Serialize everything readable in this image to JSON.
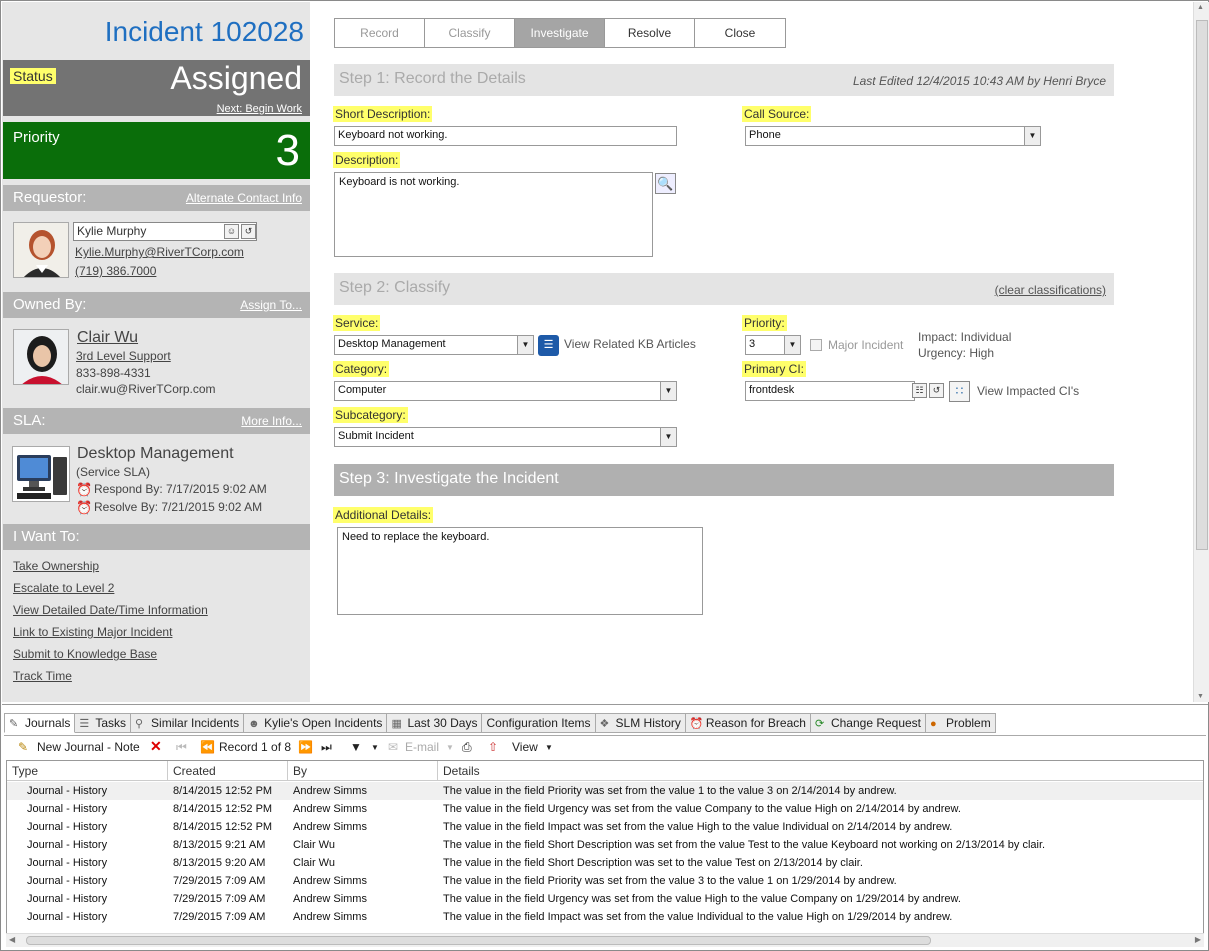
{
  "incident": {
    "title": "Incident 102028"
  },
  "status": {
    "label": "Status",
    "value": "Assigned",
    "next": "Next: Begin Work"
  },
  "priority": {
    "label": "Priority",
    "value": "3"
  },
  "requestor": {
    "head": "Requestor:",
    "link": "Alternate Contact Info",
    "name": "Kylie Murphy",
    "email": "Kylie.Murphy@RiverTCorp.com",
    "phone": "(719) 386.7000"
  },
  "owner": {
    "head": "Owned By:",
    "link": "Assign To...",
    "name": "Clair Wu",
    "group": "3rd Level Support",
    "phone": "833-898-4331",
    "email": "clair.wu@RiverTCorp.com"
  },
  "sla": {
    "head": "SLA:",
    "link": "More Info...",
    "name": "Desktop Management",
    "type": "(Service SLA)",
    "respond": "Respond By: 7/17/2015 9:02 AM",
    "resolve": "Resolve By: 7/21/2015 9:02 AM"
  },
  "iwant": {
    "head": "I Want To:",
    "links": [
      "Take Ownership",
      "Escalate to Level 2",
      "View Detailed Date/Time Information",
      "Link to Existing Major Incident",
      "Submit to Knowledge Base",
      "Track Time"
    ]
  },
  "workflow_tabs": [
    "Record",
    "Classify",
    "Investigate",
    "Resolve",
    "Close"
  ],
  "step1": {
    "title": "Step 1:  Record the Details",
    "edited": "Last Edited 12/4/2015 10:43 AM by Henri Bryce",
    "short_desc_label": "Short Description:",
    "short_desc_value": "Keyboard not working.",
    "call_source_label": "Call Source:",
    "call_source_value": "Phone",
    "desc_label": "Description:",
    "desc_value": "Keyboard is not working."
  },
  "step2": {
    "title": "Step 2:  Classify",
    "clear": "(clear classifications)",
    "service_label": "Service:",
    "service_value": "Desktop Management",
    "kb_link": "View Related KB Articles",
    "priority_label": "Priority:",
    "priority_value": "3",
    "major_incident": "Major Incident",
    "impact": "Impact: Individual",
    "urgency": "Urgency: High",
    "category_label": "Category:",
    "category_value": "Computer",
    "primary_ci_label": "Primary CI:",
    "primary_ci_value": "frontdesk",
    "impacted_ci": "View Impacted CI's",
    "subcategory_label": "Subcategory:",
    "subcategory_value": "Submit Incident"
  },
  "step3": {
    "title": "Step 3:  Investigate the Incident",
    "details_label": "Additional Details:",
    "details_value": "Need to replace the keyboard."
  },
  "bottom_tabs": [
    "Journals",
    "Tasks",
    "Similar Incidents",
    "Kylie's Open Incidents",
    "Last 30 Days",
    "Configuration Items",
    "SLM History",
    "Reason for Breach",
    "Change Request",
    "Problem"
  ],
  "toolbar": {
    "new_journal": "New Journal - Note",
    "record": "Record 1 of 8",
    "email": "E-mail",
    "view": "View"
  },
  "grid": {
    "columns": [
      "Type",
      "Created",
      "By",
      "Details"
    ],
    "rows": [
      [
        "Journal - History",
        "8/14/2015  12:52 PM",
        "Andrew Simms",
        "The value in the field Priority was set from the value 1 to the value 3 on 2/14/2014 by andrew."
      ],
      [
        "Journal - History",
        "8/14/2015  12:52 PM",
        "Andrew Simms",
        "The value in the field Urgency was set from the value Company to the value High on 2/14/2014 by andrew."
      ],
      [
        "Journal - History",
        "8/14/2015  12:52 PM",
        "Andrew Simms",
        "The value in the field Impact was set from the value High to the value Individual on 2/14/2014 by andrew."
      ],
      [
        "Journal - History",
        "8/13/2015  9:21 AM",
        "Clair Wu",
        "The value in the field Short Description was set from the value Test to the value Keyboard not working on 2/13/2014 by clair."
      ],
      [
        "Journal - History",
        "8/13/2015  9:20 AM",
        "Clair Wu",
        "The value in the field Short Description was set to the value Test on 2/13/2014 by clair."
      ],
      [
        "Journal - History",
        "7/29/2015  7:09 AM",
        "Andrew Simms",
        "The value in the field Priority was set from the value 3 to the value 1 on 1/29/2014 by andrew."
      ],
      [
        "Journal - History",
        "7/29/2015  7:09 AM",
        "Andrew Simms",
        "The value in the field Urgency was set from the value High to the value Company on 1/29/2014 by andrew."
      ],
      [
        "Journal - History",
        "7/29/2015  7:09 AM",
        "Andrew Simms",
        "The value in the field Impact was set from the value Individual to the value High on 1/29/2014 by andrew."
      ]
    ]
  }
}
